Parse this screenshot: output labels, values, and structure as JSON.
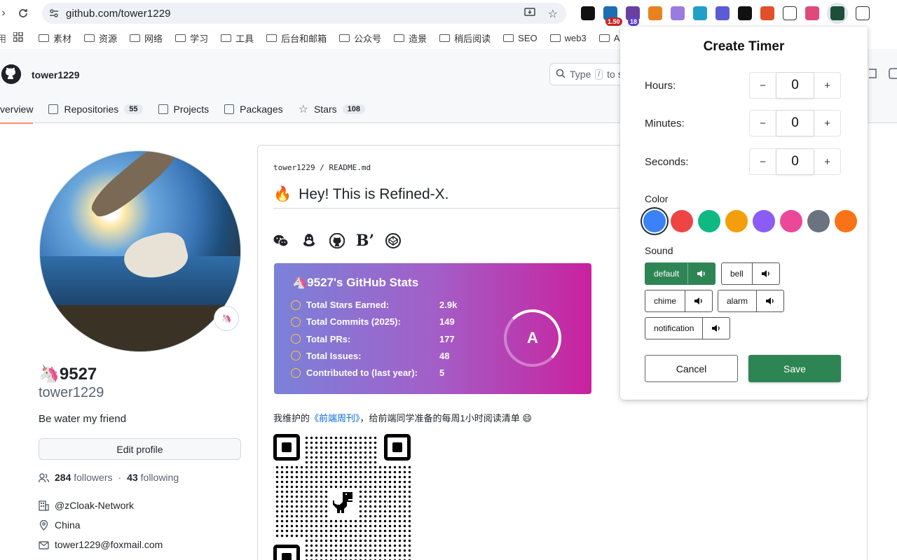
{
  "browser": {
    "url": "github.com/tower1229",
    "extensions": [
      {
        "icon": "screen-icon",
        "color": "#111111",
        "badge": ""
      },
      {
        "icon": "flag-icon",
        "color": "#1b6fb5",
        "badge": "1.50"
      },
      {
        "icon": "home-icon",
        "color": "#6b3fa0",
        "badge": "18"
      },
      {
        "icon": "fox-icon",
        "color": "#e8821e",
        "badge": ""
      },
      {
        "icon": "cloud-icon",
        "color": "#9a7be0",
        "badge": ""
      },
      {
        "icon": "tv-icon",
        "color": "#21a0c7",
        "badge": ""
      },
      {
        "icon": "tdk-icon",
        "color": "#5b5bd6",
        "badge": ""
      },
      {
        "icon": "k-icon",
        "color": "#111111",
        "badge": ""
      },
      {
        "icon": "s-icon",
        "color": "#e0502a",
        "badge": ""
      },
      {
        "icon": "r-icon",
        "color": "#ffffff",
        "badge": ""
      },
      {
        "icon": "translate-icon",
        "color": "#e04a7a",
        "badge": ""
      },
      {
        "icon": "timer-icon",
        "color": "#1e4d3a",
        "badge": ""
      },
      {
        "icon": "puzzle-icon",
        "color": "#ffffff",
        "badge": ""
      }
    ]
  },
  "bookmarks": [
    "素材",
    "资源",
    "网络",
    "学习",
    "工具",
    "后台和邮箱",
    "公众号",
    "造景",
    "稍后阅读",
    "SEO",
    "web3",
    "AI"
  ],
  "header": {
    "username": "tower1229",
    "search_text": "Type",
    "search_key": "/",
    "search_suffix": "to s"
  },
  "tabs": [
    {
      "label": "verview",
      "count": "",
      "selected": true
    },
    {
      "label": "Repositories",
      "count": "55",
      "selected": false
    },
    {
      "label": "Projects",
      "count": "",
      "selected": false
    },
    {
      "label": "Packages",
      "count": "",
      "selected": false
    },
    {
      "label": "Stars",
      "count": "108",
      "selected": false
    }
  ],
  "profile": {
    "name": "🦄9527",
    "login": "tower1229",
    "status_emoji": "🦄",
    "bio": "Be water my friend",
    "edit_label": "Edit profile",
    "followers": "284",
    "followers_label": "followers",
    "following": "43",
    "following_label": "following",
    "org": "@zCloak-Network",
    "location": "China",
    "email": "tower1229@foxmail.com"
  },
  "readme": {
    "owner": "tower1229",
    "file": "README.md",
    "title": "Hey! This is Refined-X.",
    "title_emoji": "🔥",
    "social_icons": [
      "wechat-icon",
      "qq-icon",
      "github-icon",
      "bilibili-icon",
      "codepen-icon"
    ],
    "text_before": "我维护的",
    "link": "《前端周刊》",
    "text_after": "，给前端同学准备的每周1小时阅读清单 😄"
  },
  "stats": {
    "title": "9527's GitHub Stats",
    "rank": "A",
    "rows": [
      {
        "label": "Total Stars Earned:",
        "value": "2.9k",
        "icon": "star-icon"
      },
      {
        "label": "Total Commits (2025):",
        "value": "149",
        "icon": "history-icon"
      },
      {
        "label": "Total PRs:",
        "value": "177",
        "icon": "pr-icon"
      },
      {
        "label": "Total Issues:",
        "value": "48",
        "icon": "issue-icon"
      },
      {
        "label": "Contributed to (last year):",
        "value": "5",
        "icon": "repo-icon"
      }
    ]
  },
  "timer": {
    "title": "Create Timer",
    "hours_label": "Hours:",
    "hours": "0",
    "minutes_label": "Minutes:",
    "minutes": "0",
    "seconds_label": "Seconds:",
    "seconds": "0",
    "minus": "−",
    "plus": "+",
    "color_label": "Color",
    "colors": [
      "#3b82f6",
      "#ef4444",
      "#10b981",
      "#f59e0b",
      "#8b5cf6",
      "#ec4899",
      "#6b7280",
      "#f97316"
    ],
    "selected_color": "#3b82f6",
    "sound_label": "Sound",
    "sounds": [
      "default",
      "bell",
      "chime",
      "alarm",
      "notification"
    ],
    "selected_sound": "default",
    "cancel": "Cancel",
    "save": "Save"
  }
}
